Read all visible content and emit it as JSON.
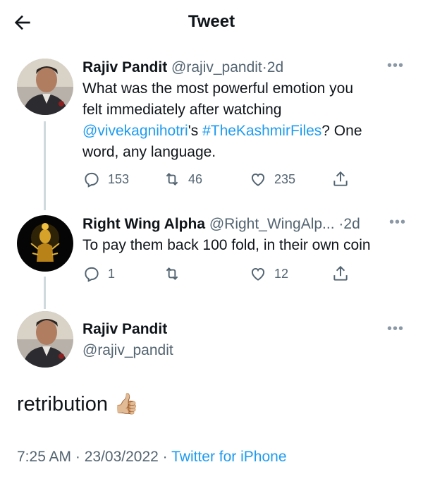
{
  "header": {
    "title": "Tweet",
    "back_icon": "arrow-left-icon"
  },
  "tweet1": {
    "name": "Rajiv Pandit",
    "handle": "@rajiv_pandit",
    "sep": "·",
    "time": "2d",
    "more": "•••",
    "line1": "What was the most powerful emotion you",
    "line2": "felt immediately after watching",
    "mention": "@vivekagnihotri",
    "apostrophe": "'s ",
    "hashtag": "#TheKashmirFiles",
    "after_hashtag": "? One",
    "line4": "word, any language.",
    "replies": "153",
    "retweets": "46",
    "likes": "235"
  },
  "tweet2": {
    "name": "Right Wing Alpha",
    "handle": "@Right_WingAlp...",
    "sep": "·",
    "time": "2d",
    "more": "•••",
    "text": "To pay them back 100 fold, in their own coin",
    "replies": "1",
    "retweets": "",
    "likes": "12"
  },
  "main_tweet": {
    "name": "Rajiv Pandit",
    "handle": "@rajiv_pandit",
    "more": "•••",
    "text": "retribution",
    "emoji": "👍🏼",
    "timestamp": "7:25 AM · 23/03/2022 · ",
    "source": "Twitter for iPhone"
  },
  "colors": {
    "link": "#1d9bf0",
    "muted": "#536471",
    "line": "#cfd9de"
  }
}
